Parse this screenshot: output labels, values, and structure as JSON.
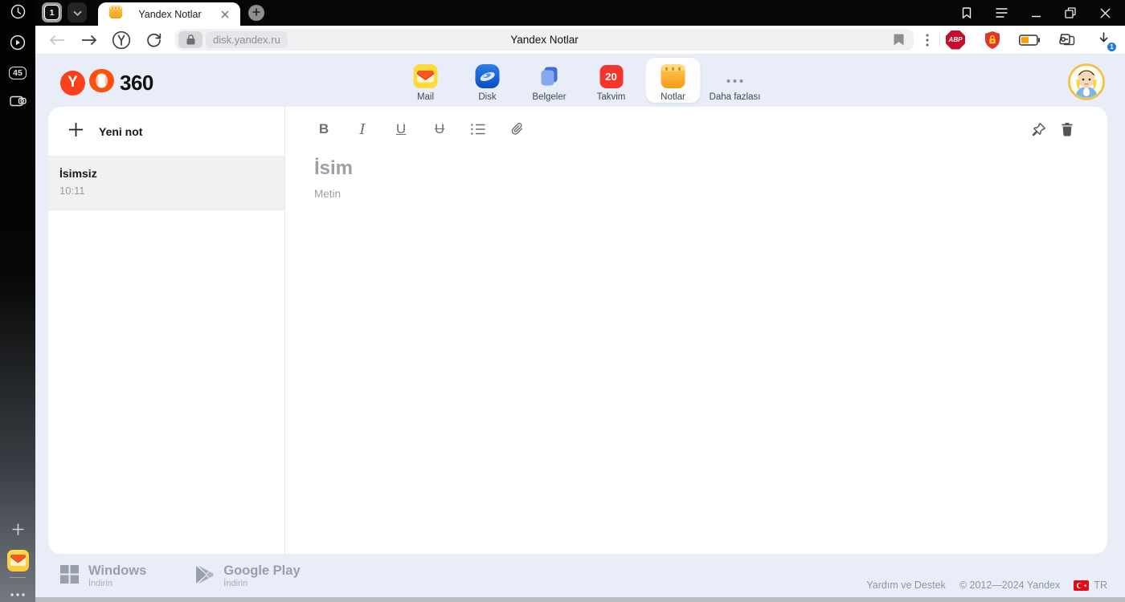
{
  "colors": {
    "accent_red": "#fc3f1d",
    "page_lavender": "#e8edf8",
    "tabbar_black": "#060606",
    "downloads_badge_blue": "#1f7ae0",
    "battery_orange": "#ffa000",
    "protect_shield_red": "#e03528",
    "abp_red": "#c70d2c",
    "avatar_ring_gold": "#f2c040",
    "calendar_red": "#f3352b",
    "selected_note_bg": "#f1f1f3"
  },
  "browser": {
    "tab_counter": "1",
    "active_tab_title": "Yandex Notlar",
    "window_title": "Yandex Notlar",
    "url": "disk.yandex.ru",
    "downloads_badge": "1",
    "rail_badge": "45",
    "abp_label": "ABP"
  },
  "header": {
    "logo_letter": "Y",
    "logo_suffix": "360",
    "services": [
      {
        "label": "Mail"
      },
      {
        "label": "Disk"
      },
      {
        "label": "Belgeler"
      },
      {
        "label": "Takvim",
        "badge": "20"
      },
      {
        "label": "Notlar"
      },
      {
        "label": "Daha fazlası"
      }
    ]
  },
  "notes_panel": {
    "new_note_label": "Yeni not",
    "items": [
      {
        "title": "İsimsiz",
        "time": "10:11"
      }
    ]
  },
  "editor": {
    "toolbar": {
      "bold": "B",
      "italic": "I",
      "underline": "U",
      "strikethrough": "U"
    },
    "title_placeholder": "İsim",
    "body_placeholder": "Metin"
  },
  "footer": {
    "apps": [
      {
        "title": "Windows",
        "subtitle": "İndirin"
      },
      {
        "title": "Google Play",
        "subtitle": "İndirin"
      }
    ],
    "help_link": "Yardım ve Destek",
    "copyright": "© 2012—2024 Yandex",
    "language": "TR"
  }
}
